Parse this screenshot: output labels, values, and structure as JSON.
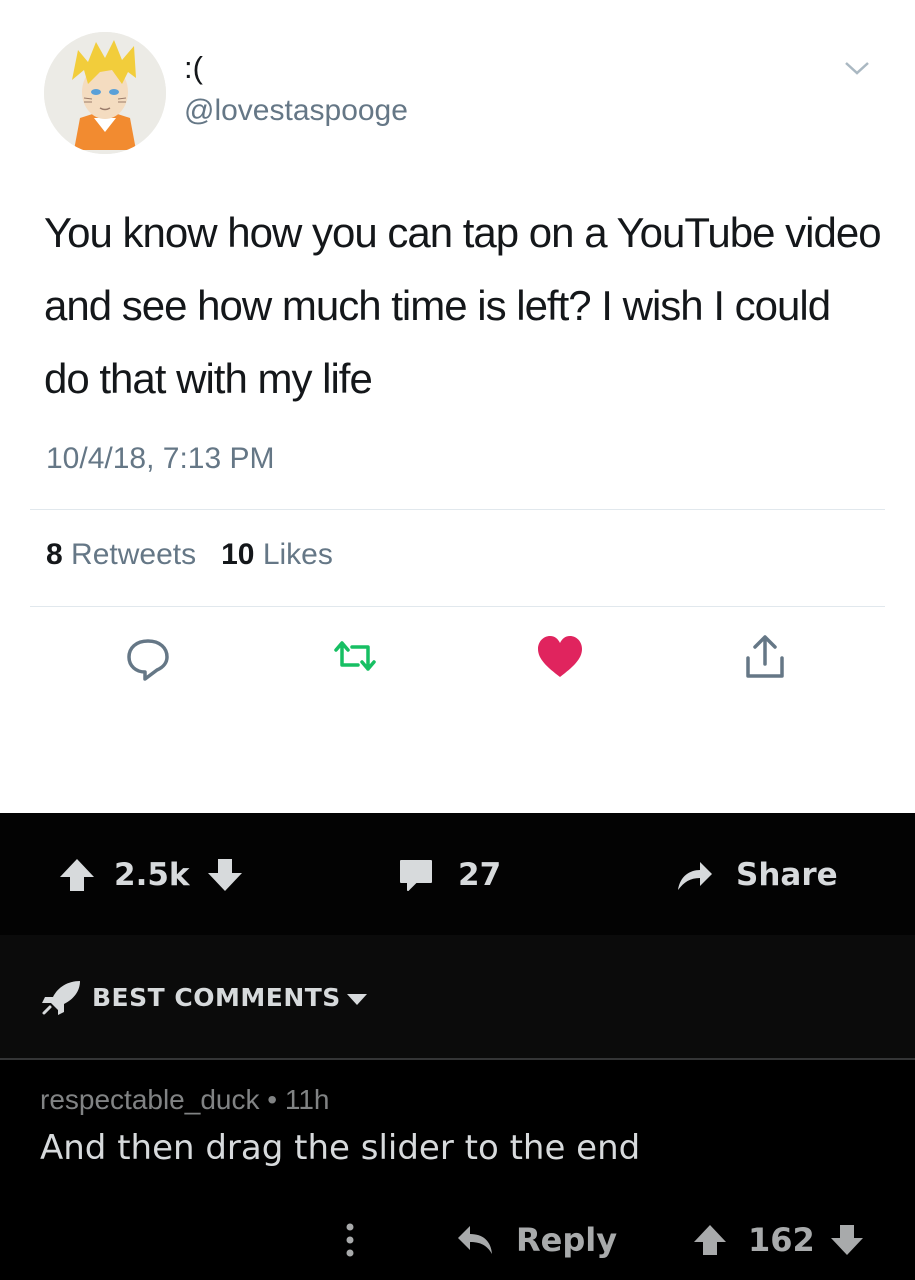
{
  "tweet": {
    "display_name": ":(",
    "handle": "@lovestaspooge",
    "text": "You know how you can tap on a YouTube video and see how much time is left? I wish I could do that with my life",
    "timestamp": "10/4/18, 7:13 PM",
    "retweet_count": "8",
    "retweet_label": "Retweets",
    "like_count": "10",
    "like_label": "Likes",
    "colors": {
      "retweet": "#17bf63",
      "like": "#e0245e",
      "icon": "#657786"
    },
    "icons": [
      "comment-icon",
      "retweet-icon",
      "like-icon",
      "share-icon",
      "chevron-down-icon"
    ]
  },
  "post_bar": {
    "votes": "2.5k",
    "comments": "27",
    "share_label": "Share"
  },
  "sort": {
    "label": "BEST COMMENTS"
  },
  "comment": {
    "author": "respectable_duck",
    "separator": "•",
    "age": "11h",
    "text": "And then drag the slider to the end",
    "reply_label": "Reply",
    "votes": "162"
  }
}
